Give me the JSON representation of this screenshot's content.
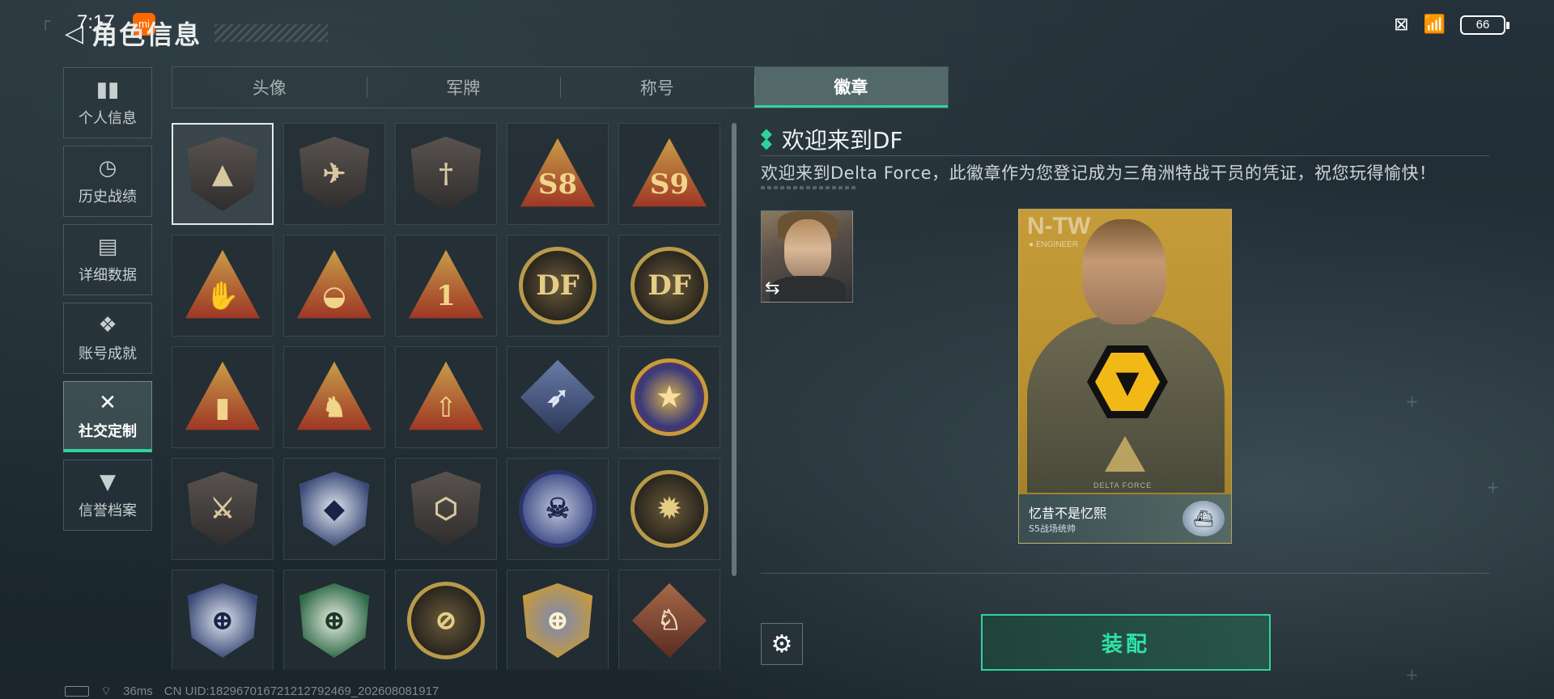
{
  "status": {
    "time": "7:17",
    "brand_badge": "mi",
    "battery": "66",
    "icons": [
      "sim-off-icon",
      "wifi-icon",
      "battery-icon"
    ]
  },
  "header": {
    "title": "角色信息",
    "back_icon": "back-arrow-icon"
  },
  "sidenav": {
    "items": [
      {
        "label": "个人信息",
        "icon": "bar-chart-icon",
        "active": false
      },
      {
        "label": "历史战绩",
        "icon": "clock-icon",
        "active": false
      },
      {
        "label": "详细数据",
        "icon": "folder-icon",
        "active": false
      },
      {
        "label": "账号成就",
        "icon": "achievement-icon",
        "active": false
      },
      {
        "label": "社交定制",
        "icon": "wrench-icon",
        "active": true
      },
      {
        "label": "信誉档案",
        "icon": "reputation-icon",
        "active": false
      }
    ]
  },
  "tabs": [
    {
      "label": "头像",
      "active": false
    },
    {
      "label": "军牌",
      "active": false
    },
    {
      "label": "称号",
      "active": false
    },
    {
      "label": "徽章",
      "active": true
    }
  ],
  "badges": [
    {
      "icon": "df-triangle-badge",
      "style": "shield",
      "glyph": "▲",
      "selected": true
    },
    {
      "icon": "helicopter-badge",
      "style": "shield",
      "glyph": "✈"
    },
    {
      "icon": "dagger-badge",
      "style": "shield",
      "glyph": "†"
    },
    {
      "icon": "s8-badge",
      "style": "tri",
      "glyph": "S8"
    },
    {
      "icon": "s9-badge",
      "style": "tri",
      "glyph": "S9"
    },
    {
      "icon": "hand-sign-badge",
      "style": "tri",
      "glyph": "✋"
    },
    {
      "icon": "nest-badge",
      "style": "tri",
      "glyph": "◒"
    },
    {
      "icon": "number-one-badge",
      "style": "tri",
      "glyph": "1"
    },
    {
      "icon": "delta-force-2025-badge",
      "style": "round",
      "glyph": "DF"
    },
    {
      "icon": "delta-force-2026-badge",
      "style": "round",
      "glyph": "DF"
    },
    {
      "icon": "usb-badge",
      "style": "tri",
      "glyph": "▮"
    },
    {
      "icon": "soldiers-badge",
      "style": "tri",
      "glyph": "♞"
    },
    {
      "icon": "rocket-badge",
      "style": "tri",
      "glyph": "⇧"
    },
    {
      "icon": "launcher-badge",
      "style": "diamond-blue",
      "glyph": "➶"
    },
    {
      "icon": "star-wolf-badge",
      "style": "star",
      "glyph": "★"
    },
    {
      "icon": "bronze-shield-badge",
      "style": "shield",
      "glyph": "⚔"
    },
    {
      "icon": "blue-crest-badge",
      "style": "navy",
      "glyph": "◆"
    },
    {
      "icon": "hexagon-badge",
      "style": "shield",
      "glyph": "⬡"
    },
    {
      "icon": "skull-badge",
      "style": "blue",
      "glyph": "☠"
    },
    {
      "icon": "tank-badge",
      "style": "round",
      "glyph": "✹"
    },
    {
      "icon": "sniper-navy-badge",
      "style": "navy",
      "glyph": "⊕"
    },
    {
      "icon": "sniper-green-badge",
      "style": "green",
      "glyph": "⊕"
    },
    {
      "icon": "rifle-badge",
      "style": "round",
      "glyph": "⊘"
    },
    {
      "icon": "sniper-gold-badge",
      "style": "gold",
      "glyph": "⊕"
    },
    {
      "icon": "wolf-head-badge",
      "style": "diamond",
      "glyph": "♘"
    }
  ],
  "detail": {
    "title": "欢迎来到DF",
    "description": "欢迎来到Delta Force，此徽章作为您登记成为三角洲特战干员的凭证，祝您玩得愉快！",
    "swap_icon": "swap-icon"
  },
  "card": {
    "code": "N-TW",
    "role": "● ENGINEER",
    "emblem": "wolf-emblem",
    "brand": "DELTA FORCE",
    "player_name": "忆昔不是忆熙",
    "rank": "S5战场统帅",
    "rank_icon": "speedboat-icon"
  },
  "actions": {
    "settings_icon": "gear-icon",
    "equip_label": "装配"
  },
  "footer": {
    "ping": "36ms",
    "uid": "CN UID:182967016721212792469_202608081917"
  },
  "colors": {
    "accent": "#2fd39a",
    "card_gold": "#c69c3a",
    "wolf_yellow": "#f2b916"
  }
}
